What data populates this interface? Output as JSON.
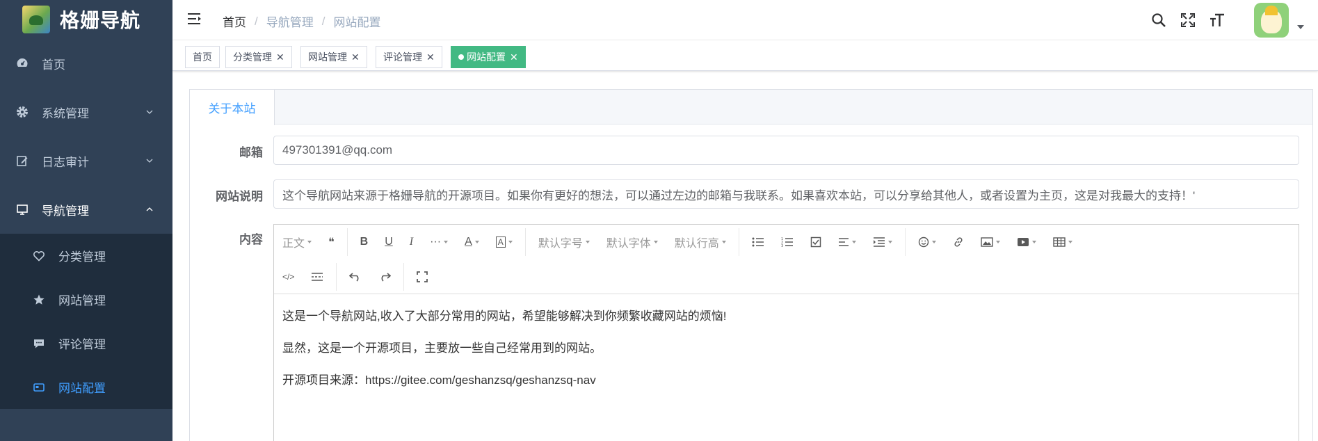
{
  "app": {
    "title": "格姗导航"
  },
  "sidebar": {
    "items": [
      {
        "label": "首页",
        "icon": "dashboard-icon"
      },
      {
        "label": "系统管理",
        "icon": "gear-icon"
      },
      {
        "label": "日志审计",
        "icon": "edit-icon"
      },
      {
        "label": "导航管理",
        "icon": "monitor-icon"
      }
    ],
    "subitems": [
      {
        "label": "分类管理",
        "icon": "heart-icon"
      },
      {
        "label": "网站管理",
        "icon": "star-icon"
      },
      {
        "label": "评论管理",
        "icon": "comment-icon"
      },
      {
        "label": "网站配置",
        "icon": "card-icon"
      }
    ]
  },
  "breadcrumb": {
    "items": [
      "首页",
      "导航管理",
      "网站配置"
    ],
    "separator": "/"
  },
  "tags": [
    {
      "label": "首页"
    },
    {
      "label": "分类管理"
    },
    {
      "label": "网站管理"
    },
    {
      "label": "评论管理"
    },
    {
      "label": "网站配置"
    }
  ],
  "card": {
    "tab": "关于本站"
  },
  "form": {
    "email_label": "邮箱",
    "email_value": "497301391@qq.com",
    "desc_label": "网站说明",
    "desc_value": "这个导航网站来源于格姗导航的开源项目。如果你有更好的想法，可以通过左边的邮箱与我联系。如果喜欢本站，可以分享给其他人，或者设置为主页，这是对我最大的支持！'",
    "content_label": "内容"
  },
  "toolbar": {
    "paragraph": "正文",
    "font_size": "默认字号",
    "font_family": "默认字体",
    "line_height": "默认行高"
  },
  "editor": {
    "lines": [
      "这是一个导航网站,收入了大部分常用的网站，希望能够解决到你频繁收藏网站的烦恼!",
      "显然，这是一个开源项目，主要放一些自己经常用到的网站。",
      "开源项目来源：https://gitee.com/geshanzsq/geshanzsq-nav"
    ]
  },
  "colors": {
    "sidebar_bg": "#304156",
    "active_menu": "#409eff",
    "active_tag": "#42b983"
  }
}
